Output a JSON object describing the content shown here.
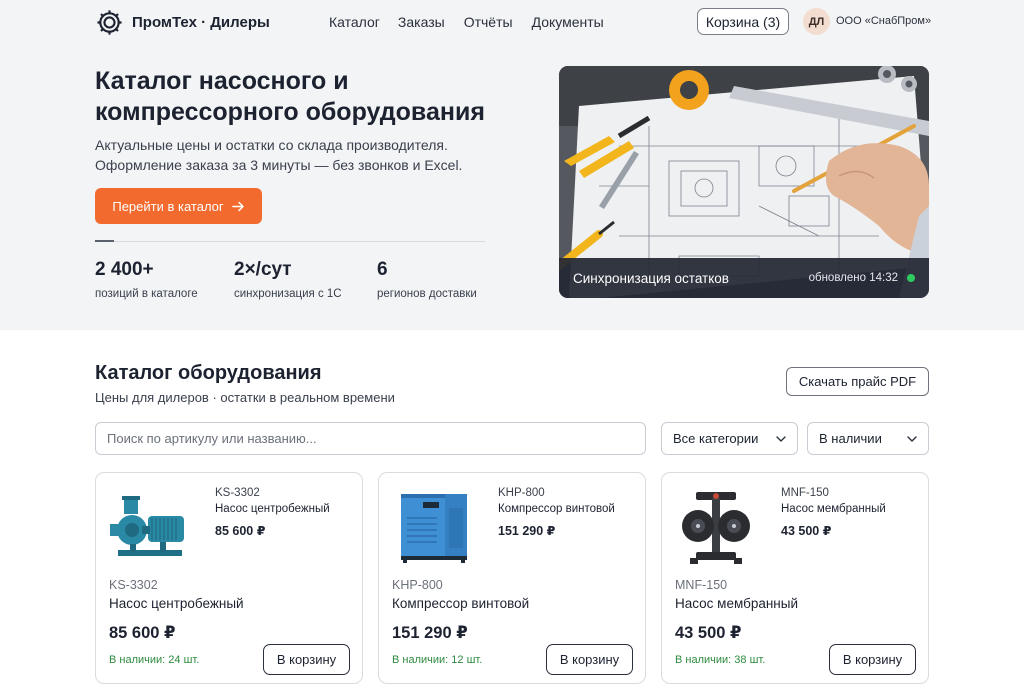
{
  "header": {
    "logo_text": "ПромТех · Дилеры",
    "nav": [
      {
        "label": "Каталог"
      },
      {
        "label": "Заказы"
      },
      {
        "label": "Отчёты"
      },
      {
        "label": "Документы"
      }
    ],
    "cart_label": "Корзина (3)",
    "avatar_initials": "ДЛ",
    "company": "ООО «СнабПром»"
  },
  "hero": {
    "title": "Каталог насосного и компрессорного оборудования",
    "subtitle": "Актуальные цены и остатки со склада производителя. Оформление заказа за 3 минуты — без звонков и Excel.",
    "cta_label": "Перейти в каталог",
    "cta_icon": "arrow-right-icon",
    "stats": [
      {
        "value": "2 400+",
        "label": "позиций в каталоге"
      },
      {
        "value": "2×/сут",
        "label": "синхронизация с 1С"
      },
      {
        "value": "6",
        "label": "регионов доставки"
      }
    ],
    "image_caption": {
      "title": "Синхронизация остатков",
      "updated": "обновлено 14:32",
      "status_color": "#2ecc5f"
    }
  },
  "catalog": {
    "title": "Каталог оборудования",
    "subtitle": "Цены для дилеров · остатки в реальном времени",
    "pdf_button": "Скачать прайс PDF",
    "search_placeholder": "Поиск по артикулу или названию...",
    "filters": {
      "category": "Все категории",
      "availability": "В наличии"
    },
    "buy_label": "В корзину",
    "products": [
      {
        "sku": "KS-3302",
        "name": "Насос центробежный",
        "price": "85 600 ₽",
        "stock": "В наличии: 24 шт.",
        "image": "centrifugal-pump"
      },
      {
        "sku": "KHP-800",
        "name": "Компрессор винтовой",
        "price": "151 290 ₽",
        "stock": "В наличии: 12 шт.",
        "image": "screw-compressor"
      },
      {
        "sku": "MNF-150",
        "name": "Насос мембранный",
        "price": "43 500 ₽",
        "stock": "В наличии: 38 шт.",
        "image": "diaphragm-pump"
      }
    ]
  },
  "colors": {
    "accent": "#f26a2e",
    "stock_green": "#2e8a3e",
    "text": "#1c2230"
  }
}
